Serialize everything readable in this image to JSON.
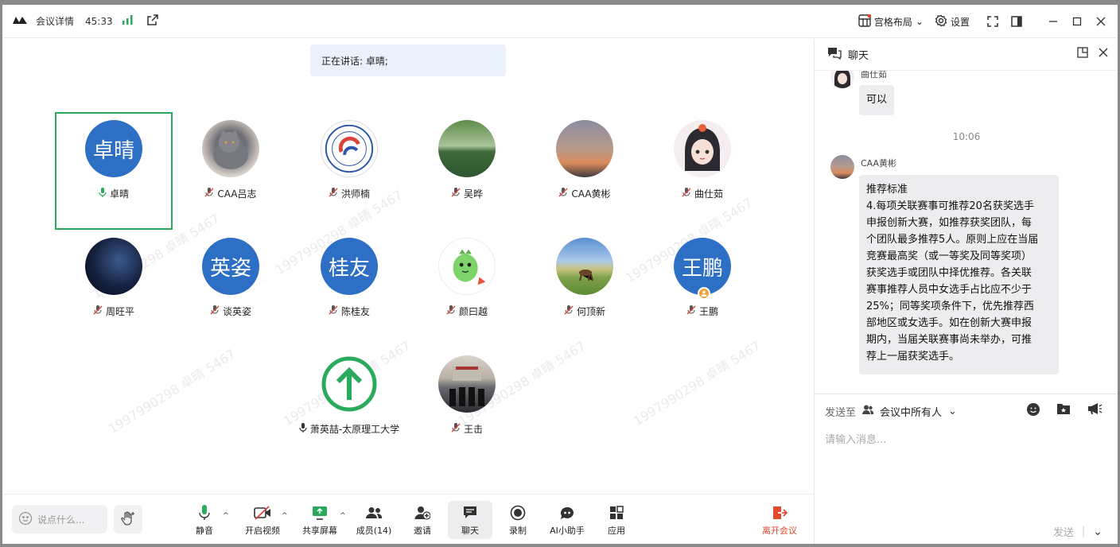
{
  "titlebar": {
    "title": "会议详情",
    "timer": "45:33",
    "layout_label": "宫格布局",
    "settings_label": "设置"
  },
  "stage": {
    "speaking_text": "正在讲话: 卓晴;",
    "watermark_text": "19979902​98 卓晴 5467",
    "participants": [
      {
        "name": "卓晴",
        "avatar_text": "卓晴",
        "mic": "on"
      },
      {
        "name": "CAA吕志",
        "avatar_text": "",
        "mic": "off"
      },
      {
        "name": "洪师楠",
        "avatar_text": "",
        "mic": "off"
      },
      {
        "name": "吴晔",
        "avatar_text": "",
        "mic": "off"
      },
      {
        "name": "CAA黄彬",
        "avatar_text": "",
        "mic": "off"
      },
      {
        "name": "曲仕茹",
        "avatar_text": "",
        "mic": "off"
      },
      {
        "name": "周旺平",
        "avatar_text": "",
        "mic": "off"
      },
      {
        "name": "谈英姿",
        "avatar_text": "英姿",
        "mic": "off"
      },
      {
        "name": "陈桂友",
        "avatar_text": "桂友",
        "mic": "off"
      },
      {
        "name": "颜曰越",
        "avatar_text": "",
        "mic": "off"
      },
      {
        "name": "何顶新",
        "avatar_text": "",
        "mic": "off"
      },
      {
        "name": "王鹏",
        "avatar_text": "王鹏",
        "mic": "off"
      },
      {
        "name": "萧英喆-太原理工大学",
        "avatar_text": "",
        "mic": "on-idle"
      },
      {
        "name": "王击",
        "avatar_text": "",
        "mic": "off"
      }
    ]
  },
  "toolbar": {
    "say_placeholder": "说点什么...",
    "mute": "静音",
    "video": "开启视频",
    "share": "共享屏幕",
    "members": "成员(14)",
    "invite": "邀请",
    "chat": "聊天",
    "record": "录制",
    "ai": "AI小助手",
    "apps": "应用",
    "leave": "离开会议"
  },
  "chat": {
    "title": "聊天",
    "messages": [
      {
        "sender": "曲仕茹",
        "text": "可以"
      },
      {
        "timestamp": "10:06"
      },
      {
        "sender": "CAA黄彬",
        "lines": [
          "推荐标准",
          "4.每项关联赛事可推荐20名获奖选手",
          "申报创新大赛，如推荐获奖团队，每",
          "个团队最多推荐5人。原则上应在当届",
          "竞赛最高奖（或一等奖及同等奖项）",
          "获奖选手或团队中择优推荐。各关联",
          "赛事推荐人员中女选手占比应不少于",
          "25%；同等奖项条件下，优先推荐西",
          "部地区或女选手。如在创新大赛申报",
          "期内，当届关联赛事尚未举办，可推",
          "荐上一届获奖选手。"
        ]
      }
    ],
    "send_to_label": "发送至",
    "send_to_value": "会议中所有人",
    "input_placeholder": "请输入消息...",
    "send_label": "发送"
  },
  "colors": {
    "accent_green": "#2aaa5c",
    "avatar_blue": "#2d6fc4",
    "leave_red": "#e24a2e",
    "muted_red": "#d9453b"
  }
}
